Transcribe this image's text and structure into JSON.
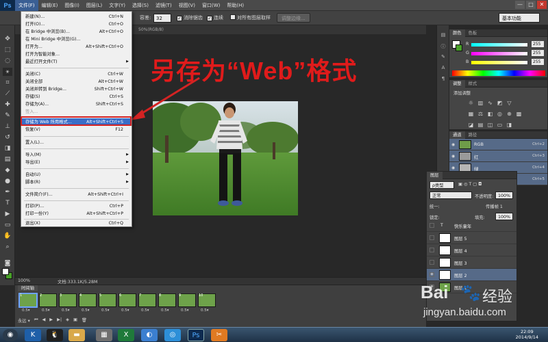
{
  "app": {
    "logo": "Ps",
    "menus": [
      "文件(F)",
      "编辑(E)",
      "图像(I)",
      "图层(L)",
      "文字(Y)",
      "选择(S)",
      "滤镜(T)",
      "视图(V)",
      "窗口(W)",
      "帮助(H)"
    ],
    "window_controls": [
      "—",
      "□",
      "✕"
    ]
  },
  "options_bar": {
    "tolerance_label": "容差:",
    "tolerance_value": "32",
    "antialias_label": "消除锯齿",
    "contiguous_label": "连续",
    "sample_all_label": "对所有图层取样",
    "refine_edge_label": "调整边缘...",
    "workspace": "基本功能"
  },
  "document": {
    "tab_fragment": "50%(RGB/8)",
    "zoom": "100%",
    "doc_info": "文档:333.1K/5.28M"
  },
  "annotation": {
    "headline": "另存为“Web”格式"
  },
  "file_menu": {
    "items": [
      {
        "label": "新建(N)...",
        "shortcut": "Ctrl+N"
      },
      {
        "label": "打开(O)...",
        "shortcut": "Ctrl+O"
      },
      {
        "label": "在 Bridge 中浏览(B)...",
        "shortcut": "Alt+Ctrl+O"
      },
      {
        "label": "在 Mini Bridge 中浏览(G)...",
        "shortcut": ""
      },
      {
        "label": "打开为...",
        "shortcut": "Alt+Shift+Ctrl+O"
      },
      {
        "label": "打开为智能对象...",
        "shortcut": ""
      },
      {
        "label": "最近打开文件(T)",
        "shortcut": ""
      },
      {
        "label": "关闭(C)",
        "shortcut": "Ctrl+W"
      },
      {
        "label": "关闭全部",
        "shortcut": "Alt+Ctrl+W"
      },
      {
        "label": "关闭并转到 Bridge...",
        "shortcut": "Shift+Ctrl+W"
      },
      {
        "label": "存储(S)",
        "shortcut": "Ctrl+S"
      },
      {
        "label": "存储为(A)...",
        "shortcut": "Shift+Ctrl+S"
      },
      {
        "label": "签入...",
        "shortcut": ""
      },
      {
        "label": "存储为 Web 所用格式...",
        "shortcut": "Alt+Shift+Ctrl+S"
      },
      {
        "label": "恢复(V)",
        "shortcut": "F12"
      },
      {
        "label": "置入(L)...",
        "shortcut": ""
      },
      {
        "label": "导入(M)",
        "shortcut": ""
      },
      {
        "label": "导出(E)",
        "shortcut": ""
      },
      {
        "label": "自动(U)",
        "shortcut": ""
      },
      {
        "label": "脚本(R)",
        "shortcut": ""
      },
      {
        "label": "文件简介(F)...",
        "shortcut": "Alt+Shift+Ctrl+I"
      },
      {
        "label": "打印(P)...",
        "shortcut": "Ctrl+P"
      },
      {
        "label": "打印一份(Y)",
        "shortcut": "Alt+Shift+Ctrl+P"
      },
      {
        "label": "退出(X)",
        "shortcut": "Ctrl+Q"
      }
    ]
  },
  "color_panel": {
    "tabs": [
      "颜色",
      "色板"
    ],
    "r_label": "R",
    "r_value": "255",
    "g_label": "G",
    "g_value": "255",
    "b_label": "B",
    "b_value": "255"
  },
  "adjustments_panel": {
    "tabs": [
      "调整",
      "样式"
    ],
    "title": "添加调整"
  },
  "channels_panel": {
    "tabs": [
      "通道",
      "路径"
    ],
    "rows": [
      {
        "name": "RGB",
        "shortcut": "Ctrl+2"
      },
      {
        "name": "红",
        "shortcut": "Ctrl+3"
      },
      {
        "name": "绿",
        "shortcut": "Ctrl+4"
      },
      {
        "name": "",
        "shortcut": "Ctrl+5"
      }
    ]
  },
  "layers_panel": {
    "tab": "图层",
    "filter": "ρ类型",
    "blend_mode": "正常",
    "opacity_label": "不透明度:",
    "opacity_value": "100%",
    "unify_label": "统一:",
    "propagate_label": "传播帧 1",
    "lock_label": "锁定:",
    "fill_label": "填充:",
    "fill_value": "100%",
    "layers": [
      {
        "name": "快乐童年"
      },
      {
        "name": "图层 5"
      },
      {
        "name": "图层 4"
      },
      {
        "name": "图层 3"
      },
      {
        "name": "图层 2"
      },
      {
        "name": "图层 1"
      }
    ]
  },
  "timeline": {
    "tab": "时间轴",
    "frames": [
      {
        "num": "1",
        "delay": "0.5▾"
      },
      {
        "num": "2",
        "delay": "0.5▾"
      },
      {
        "num": "3",
        "delay": "0.5▾"
      },
      {
        "num": "4",
        "delay": "0.5▾"
      },
      {
        "num": "5",
        "delay": "0.5▾"
      },
      {
        "num": "6",
        "delay": "0.5▾"
      },
      {
        "num": "7",
        "delay": "0.5▾"
      },
      {
        "num": "8",
        "delay": "0.5▾"
      },
      {
        "num": "9",
        "delay": "0.5▾"
      },
      {
        "num": "10",
        "delay": "0.5▾"
      }
    ],
    "loop": "永远 ▾"
  },
  "taskbar": {
    "time": "22:09",
    "date": "2014/9/14"
  },
  "watermark": {
    "brand": "Bai",
    "brand2": "经验",
    "url": "jingyan.baidu.com"
  }
}
